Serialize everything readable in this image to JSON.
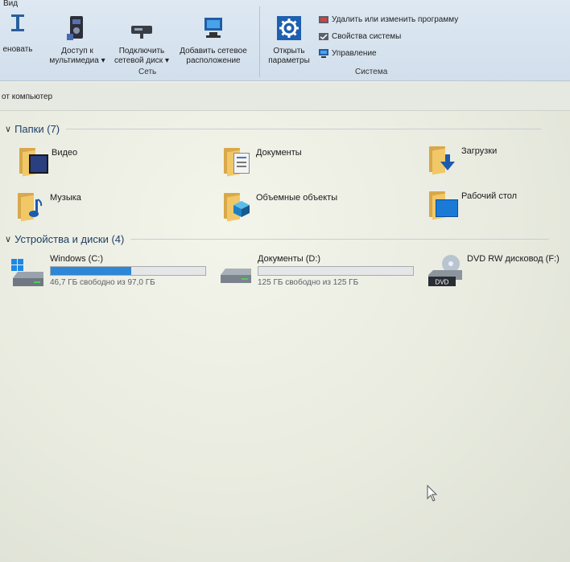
{
  "ribbon": {
    "tab": "Вид",
    "buttons": {
      "rename": "еновать",
      "media": [
        "Доступ к",
        "мультимедиа ▾"
      ],
      "map_drive": [
        "Подключить",
        "сетевой диск ▾"
      ],
      "add_location": [
        "Добавить сетевое",
        "расположение"
      ],
      "open_settings": [
        "Открыть",
        "параметры"
      ]
    },
    "group_network": "Сеть",
    "group_system": "Система",
    "small_commands": {
      "uninstall": "Удалить или изменить программу",
      "properties": "Свойства системы",
      "manage": "Управление"
    }
  },
  "address": {
    "text": "от компьютер"
  },
  "folders_section": {
    "title": "Папки (7)",
    "items": [
      {
        "label": "Видео",
        "icon": "video-folder-icon"
      },
      {
        "label": "Документы",
        "icon": "documents-folder-icon"
      },
      {
        "label": "Загрузки",
        "icon": "downloads-folder-icon"
      },
      {
        "label": "Музыка",
        "icon": "music-folder-icon"
      },
      {
        "label": "Объемные объекты",
        "icon": "3d-objects-folder-icon"
      },
      {
        "label": "Рабочий стол",
        "icon": "desktop-folder-icon"
      }
    ]
  },
  "devices_section": {
    "title": "Устройства и диски (4)",
    "drives": [
      {
        "name": "Windows (C:)",
        "free": "46,7 ГБ свободно из 97,0 ГБ",
        "used_fraction": 0.52
      },
      {
        "name": "Документы (D:)",
        "free": "125 ГБ свободно из 125 ГБ",
        "used_fraction": 0.0
      },
      {
        "name": "DVD RW дисковод (F:)",
        "dvd_label": "DVD"
      }
    ]
  },
  "colors": {
    "accent": "#2d86d6",
    "folder": "#f0c868",
    "section_title": "#1e3f66"
  }
}
